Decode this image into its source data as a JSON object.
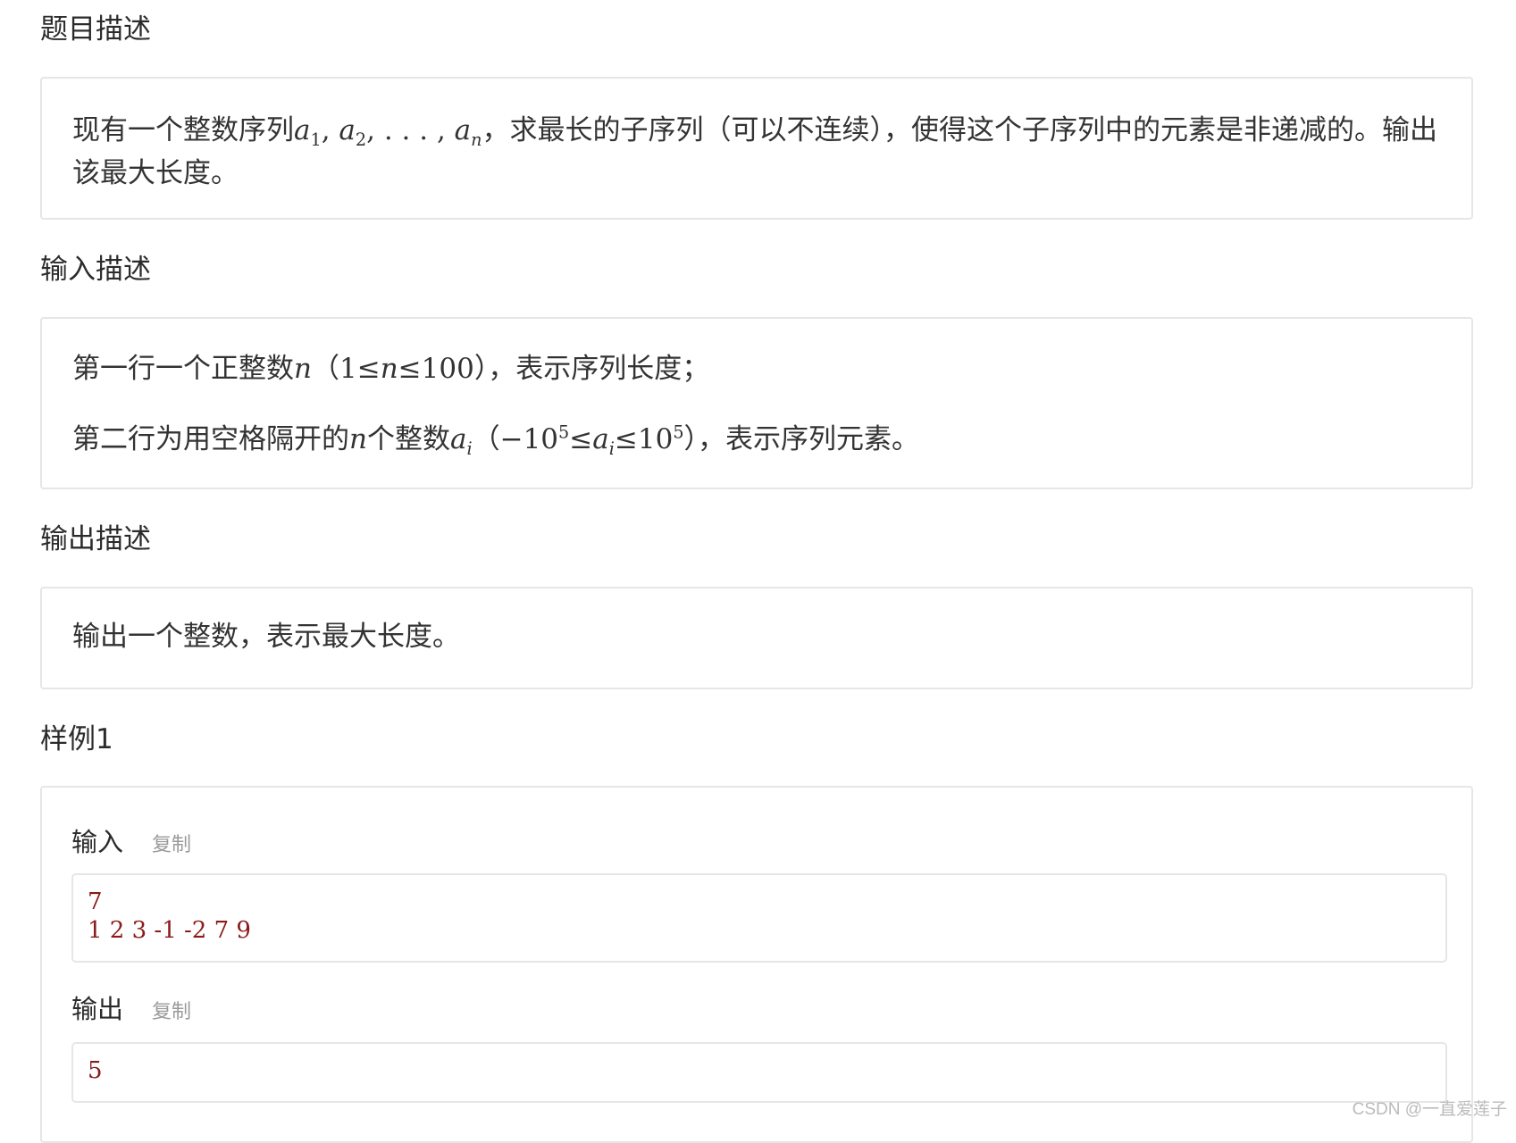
{
  "sections": {
    "description": {
      "title": "题目描述",
      "text_before": "现有一个整数序列",
      "seq_a1": "a",
      "seq_sub1": "1",
      "seq_sep1": ", ",
      "seq_a2": "a",
      "seq_sub2": "2",
      "seq_sep2": ", . . . , ",
      "seq_an": "a",
      "seq_subn": "n",
      "text_after": "，求最长的子序列（可以不连续），使得这个子序列中的元素是非递减的。输出该最大长度。"
    },
    "input": {
      "title": "输入描述",
      "line1_before": "第一行一个正整数",
      "line1_var": "n",
      "line1_paren_open": "（",
      "line1_min": "1",
      "line1_le1": "≤",
      "line1_var2": "n",
      "line1_le2": "≤",
      "line1_max": "100",
      "line1_after": "），表示序列长度；",
      "line2_before": "第二行为用空格隔开的",
      "line2_var": "n",
      "line2_mid": "个整数",
      "line2_ai": "a",
      "line2_ai_sub": "i",
      "line2_paren_open": "（",
      "line2_min": "−10",
      "line2_min_exp": "5",
      "line2_le1": "≤",
      "line2_ai2": "a",
      "line2_ai2_sub": "i",
      "line2_le2": "≤",
      "line2_max": "10",
      "line2_max_exp": "5",
      "line2_after": "），表示序列元素。"
    },
    "output": {
      "title": "输出描述",
      "text": "输出一个整数，表示最大长度。"
    },
    "sample": {
      "title": "样例1",
      "input_label": "输入",
      "input_copy": "复制",
      "input_line1": "7",
      "input_line2": "1 2 3 -1 -2 7 9",
      "output_label": "输出",
      "output_copy": "复制",
      "output_value": "5"
    }
  },
  "watermark": "CSDN @一直爱莲子"
}
